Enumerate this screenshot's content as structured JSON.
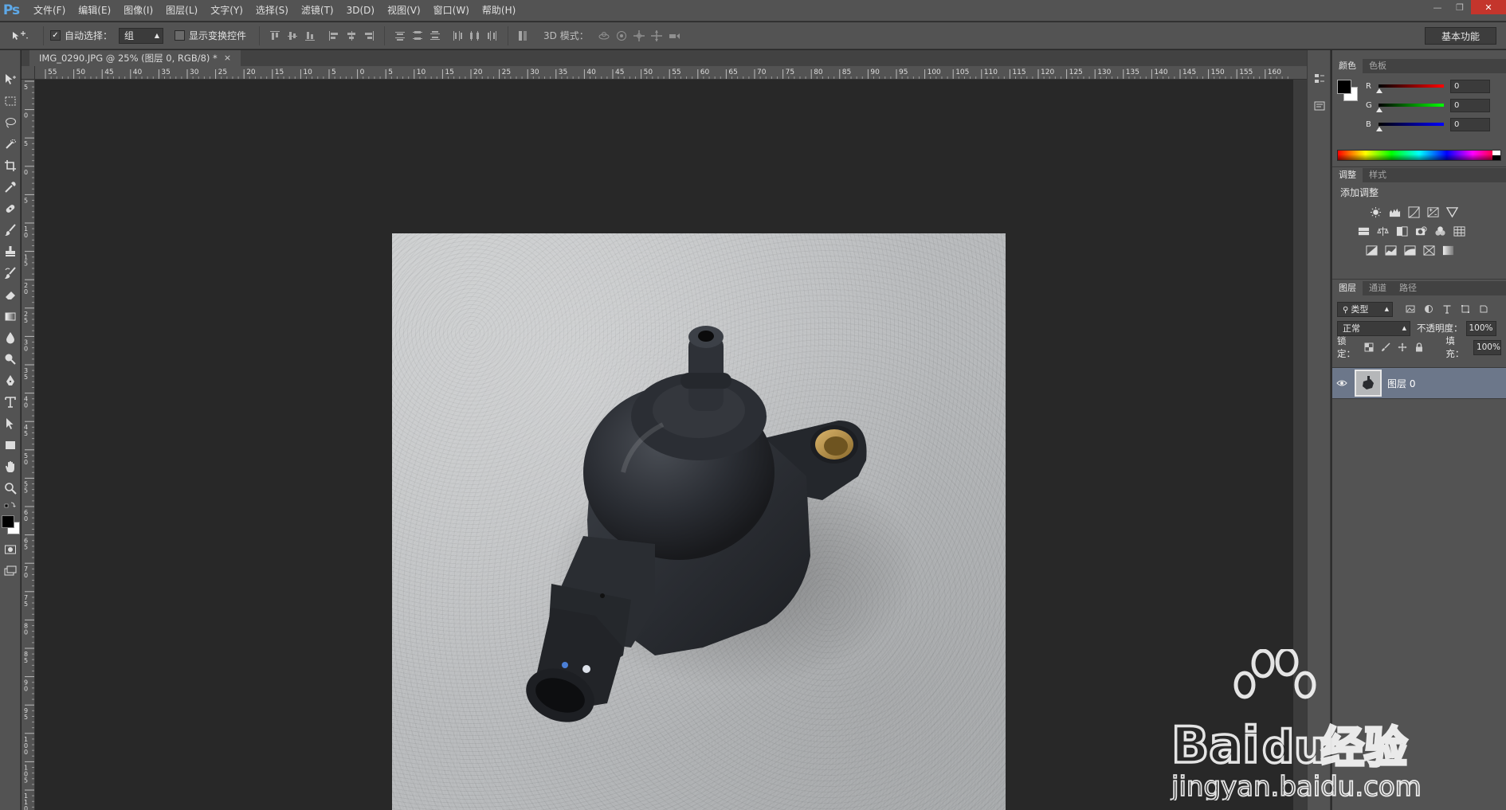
{
  "app": {
    "logo": "Ps"
  },
  "menu": [
    "文件(F)",
    "编辑(E)",
    "图像(I)",
    "图层(L)",
    "文字(Y)",
    "选择(S)",
    "滤镜(T)",
    "3D(D)",
    "视图(V)",
    "窗口(W)",
    "帮助(H)"
  ],
  "options": {
    "auto_select_label": "自动选择：",
    "auto_select_value": "组",
    "show_transform_label": "显示变换控件",
    "mode3d_label": "3D 模式：",
    "workspace": "基本功能"
  },
  "document": {
    "tab_title": "IMG_0290.JPG @ 25% (图层 0, RGB/8) *",
    "close_glyph": "×"
  },
  "ruler": {
    "h_ticks": [
      "55",
      "50",
      "45",
      "40",
      "35",
      "30",
      "25",
      "20",
      "15",
      "10",
      "5",
      "0",
      "5",
      "10",
      "15",
      "20",
      "25",
      "30",
      "35",
      "40",
      "45",
      "50",
      "55",
      "60",
      "65",
      "70",
      "75",
      "80",
      "85",
      "90",
      "95",
      "100",
      "105",
      "110",
      "115",
      "120",
      "125",
      "130",
      "135",
      "140",
      "145",
      "150",
      "155",
      "160"
    ],
    "v_ticks": [
      "5",
      "0",
      "5",
      "0",
      "5",
      "1 0",
      "1 5",
      "2 0",
      "2 5",
      "3 0",
      "3 5",
      "4 0",
      "4 5",
      "5 0",
      "5 5",
      "6 0",
      "6 5",
      "7 0",
      "7 5",
      "8 0",
      "8 5",
      "9 0",
      "9 5",
      "1 0 0",
      "1 0 5",
      "1 1 0"
    ]
  },
  "color_panel": {
    "tabs": [
      "颜色",
      "色板"
    ],
    "channels": [
      {
        "name": "R",
        "value": "0",
        "color": "#ff0000"
      },
      {
        "name": "G",
        "value": "0",
        "color": "#00ff00"
      },
      {
        "name": "B",
        "value": "0",
        "color": "#0000ff"
      }
    ],
    "foreground": "#000000",
    "background": "#ffffff"
  },
  "adjustments_panel": {
    "tabs": [
      "调整",
      "样式"
    ],
    "title": "添加调整"
  },
  "layers_panel": {
    "tabs": [
      "图层",
      "通道",
      "路径"
    ],
    "filter_kind": "类型",
    "blend_mode": "正常",
    "opacity_label": "不透明度：",
    "opacity_value": "100%",
    "lock_label": "锁定：",
    "fill_label": "填充：",
    "fill_value": "100%",
    "layers": [
      {
        "name": "图层 0",
        "visible": true
      }
    ]
  },
  "watermark": {
    "brand": "Bai",
    "brand2": "du",
    "cn": "经验",
    "url": "jingyan.baidu.com"
  }
}
